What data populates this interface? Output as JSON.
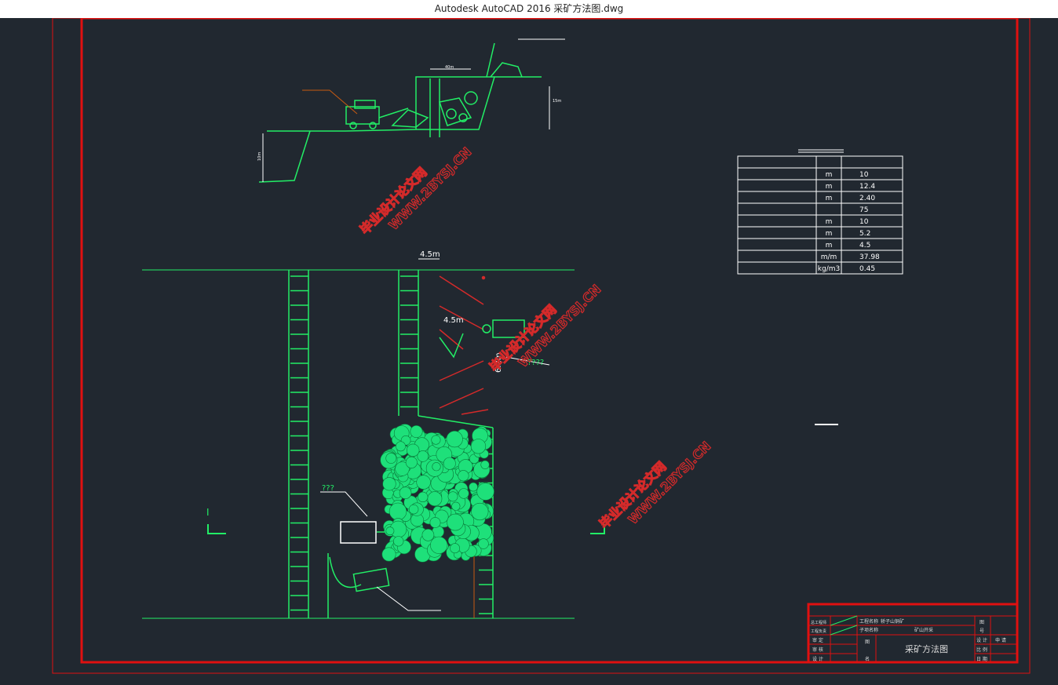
{
  "window": {
    "title": "Autodesk AutoCAD 2016     采矿方法图.dwg"
  },
  "dims": {
    "top_width": "4.5m",
    "inner_width": "4.5m",
    "vertical": "6.2m",
    "label_a": "????",
    "label_b": "???",
    "section_mark": "I",
    "small_a": "40m",
    "small_b": "15m",
    "small_c": "10m"
  },
  "params_table": {
    "rows": [
      {
        "unit": "",
        "value": ""
      },
      {
        "unit": "m",
        "value": "10"
      },
      {
        "unit": "m",
        "value": "12.4"
      },
      {
        "unit": "m",
        "value": "2.40"
      },
      {
        "unit": "",
        "value": "75"
      },
      {
        "unit": "m",
        "value": "10"
      },
      {
        "unit": "m",
        "value": "5.2"
      },
      {
        "unit": "m",
        "value": "4.5"
      },
      {
        "unit": "m/m",
        "value": "37.98"
      },
      {
        "unit": "kg/m3",
        "value": "0.45"
      }
    ]
  },
  "watermarks": [
    {
      "cn": "毕业设计论文网",
      "url": "WWW.2BYSJ.CN"
    },
    {
      "cn": "毕业设计论文网",
      "url": "WWW.2BYSJ.CN"
    },
    {
      "cn": "毕业设计论文网",
      "url": "WWW.2BYSJ.CN"
    }
  ],
  "title_block": {
    "project_label": "工程名称",
    "project_value": "轿子山铜矿",
    "sub_label": "子项名称",
    "sub_value": "矿山开采",
    "drawing_title": "采矿方法图",
    "rows_left": [
      "总工程师",
      "工程负责",
      "审 定",
      "审 核",
      "设 计"
    ],
    "figure_label": "图",
    "name_label": "名",
    "right_labels": [
      "图",
      "号",
      "设 计",
      "比 例",
      "日 期"
    ],
    "stage": "申 请"
  },
  "colors": {
    "background": "#212830",
    "frame": "#e01010",
    "geometry": "#22ee66",
    "dim": "#ffffff",
    "watermark": "#d42a2a"
  }
}
